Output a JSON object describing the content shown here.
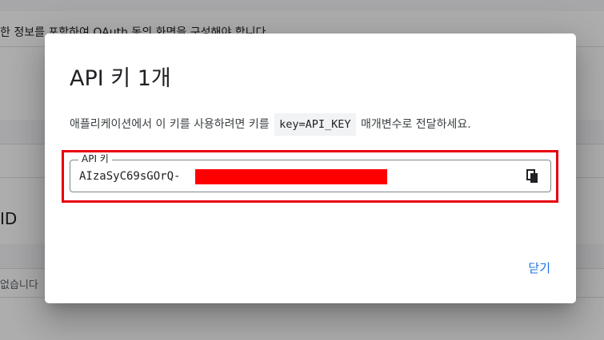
{
  "background": {
    "top_text": "한 정보를 포함하여 OAuth 동의 화면을 구성해야 합니다.",
    "id_label": "ID",
    "empty_text": "없습니다"
  },
  "dialog": {
    "title": "API 키 1개",
    "description_before": "애플리케이션에서 이 키를 사용하려면 키를",
    "description_code": "key=API_KEY",
    "description_after": "매개변수로 전달하세요.",
    "field_label": "API 키",
    "key_value_visible": "AIzaSyC69sGOrQ-",
    "copy_icon": "copy-icon",
    "close_label": "닫기"
  },
  "colors": {
    "accent": "#1a73e8",
    "annotation": "#e8000b",
    "redaction": "#ff0000"
  }
}
